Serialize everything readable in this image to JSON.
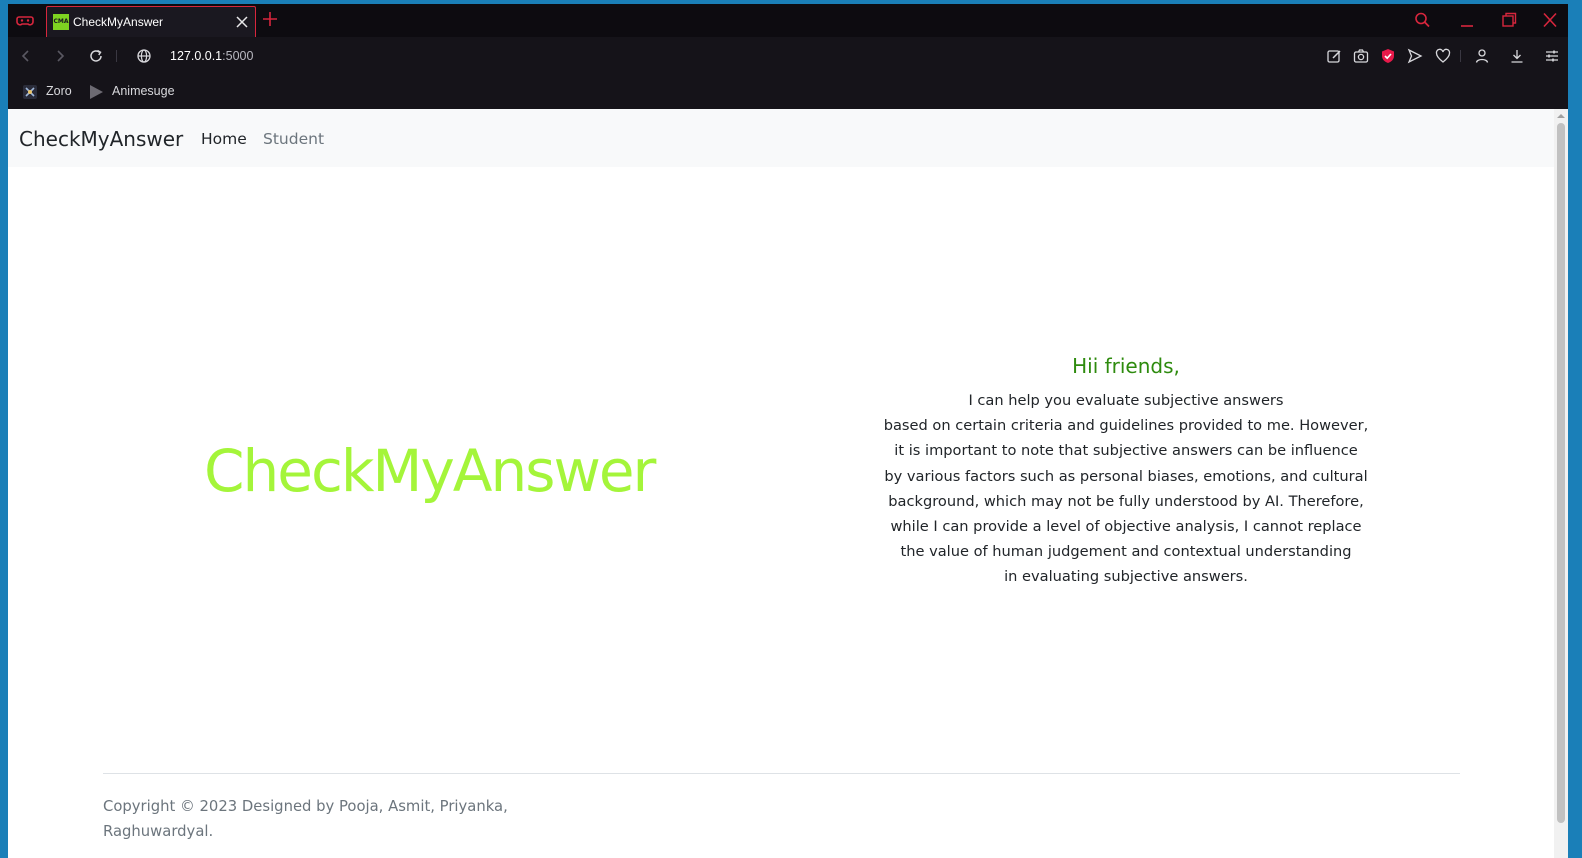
{
  "browser": {
    "tab": {
      "favicon_text": "CMA",
      "title": "CheckMyAnswer"
    },
    "address": {
      "host": "127.0.0.1",
      "port": ":5000"
    },
    "bookmarks": [
      {
        "label": "Zoro",
        "icon": "zoro-icon"
      },
      {
        "label": "Animesuge",
        "icon": "play-icon"
      }
    ],
    "accent_color": "#d7263d"
  },
  "navbar": {
    "brand": "CheckMyAnswer",
    "links": [
      {
        "label": "Home",
        "active": true
      },
      {
        "label": "Student",
        "active": false
      }
    ]
  },
  "hero": {
    "title": "CheckMyAnswer",
    "title_color": "#a4f53a",
    "greeting": "Hii friends,",
    "greeting_color": "#2e8b0e",
    "paragraph_lines": [
      "I can help you evaluate subjective answers",
      "based on certain criteria and guidelines provided to me. However,",
      "it is important to note that subjective answers can be influence",
      "by various factors such as personal biases, emotions, and cultural",
      "background, which may not be fully understood by AI. Therefore,",
      "while I can provide a level of objective analysis, I cannot replace",
      "the value of human judgement and contextual understanding",
      "in evaluating subjective answers."
    ]
  },
  "footer": {
    "copyright_line1": "Copyright © 2023 Designed by Pooja, Asmit, Priyanka,",
    "copyright_line2": "Raghuwardyal."
  }
}
